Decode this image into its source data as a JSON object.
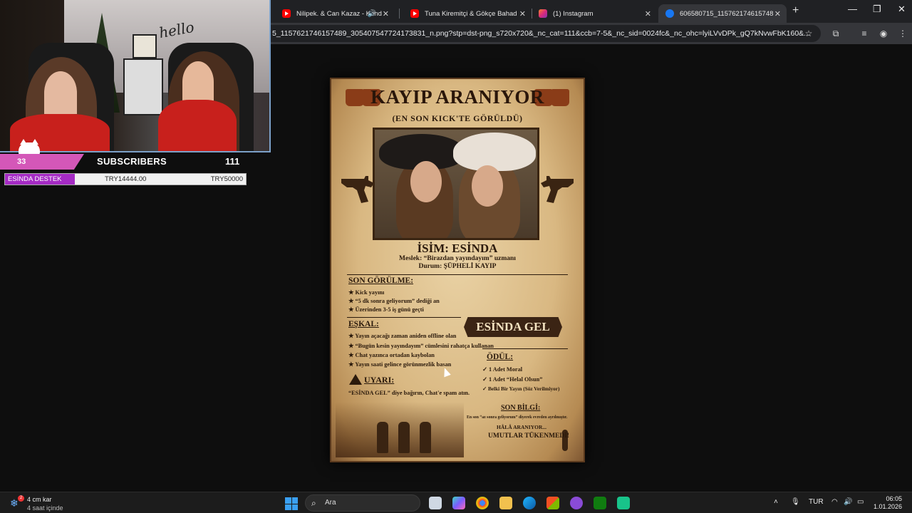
{
  "browser": {
    "tabs": [
      {
        "title": "Nilipek. & Can Kazaz - Kend",
        "icon": "youtube-icon"
      },
      {
        "title": "Tuna Kiremitçi & Gökçe Bahad",
        "icon": "youtube-icon"
      },
      {
        "title": "(1) Instagram",
        "icon": "instagram-icon"
      },
      {
        "title": "606580715_115762174615748",
        "icon": "facebook-icon"
      }
    ],
    "url": "5_1157621746157489_305407547724173831_n.png?stp=dst-png_s720x720&_nc_cat=111&ccb=7-5&_nc_sid=0024fc&_nc_ohc=lyiLVvDPk_gQ7kNvwFbK160&..."
  },
  "overlay": {
    "sub_number": "33",
    "sub_label": "SUBSCRIBERS",
    "sub_count": "111",
    "hello_sign": "hello",
    "donation": {
      "label": "ESİNDA DESTEK",
      "current": "TRY14444.00",
      "goal": "TRY50000",
      "progress_fraction": 0.289
    }
  },
  "poster": {
    "title": "KAYIP ARANIYOR",
    "subtitle": "(EN SON KICK'TE GÖRÜLDÜ)",
    "name": "İSİM: ESİNDA",
    "job": "Meslek: “Birazdan yayındayım” uzmanı",
    "status": "Durum: ŞÜPHELİ KAYIP",
    "last_seen_heading": "SON GÖRÜLME:",
    "last_seen_items": [
      "★ Kick yayını",
      "★ “5 dk sonra geliyorum” dediği an",
      "★ Üzerinden 3-5 iş günü geçti"
    ],
    "description_heading": "EŞKAL:",
    "description_items": [
      "★ Yayın açacağı zaman aniden offline olan",
      "★ “Bugün kesin yayındayım” cümlesini rahatça kullanan",
      "★ Chat yazınca ortadan kaybolan",
      "★ Yayın saati gelince görünmezlik basan"
    ],
    "banner": "ESİNDA GEL",
    "reward_heading": "ÖDÜL:",
    "reward_items": [
      "✓ 1 Adet Moral",
      "✓ 1 Adet “Helal Olsun”",
      "✓ Belki Bir Yayın (Söz Verilmiyor)"
    ],
    "warning_heading": "UYARI:",
    "warning_text": "“ESİNDA GEL” diye bağırın, Chat'e spam atın.",
    "info_heading": "SON BİLGİ:",
    "info_line1": "En son “az sonra geliyorum” diyerek evreden ayrılmıştır.",
    "info_line2": "HÂLÂ ARANIYOR...",
    "info_line3": "UMUTLAR TÜKENMEDİ!"
  },
  "taskbar": {
    "weather_temp": "4 cm kar",
    "weather_cond": "4 saat içinde",
    "weather_badge": "2",
    "search_placeholder": "Ara",
    "language": "TUR",
    "time": "06:05",
    "date": "1.01.2026"
  },
  "colors": {
    "accent_pink": "#d457b8",
    "donation_fill": "#a52bc4",
    "poster_paper": "#d9b882"
  }
}
